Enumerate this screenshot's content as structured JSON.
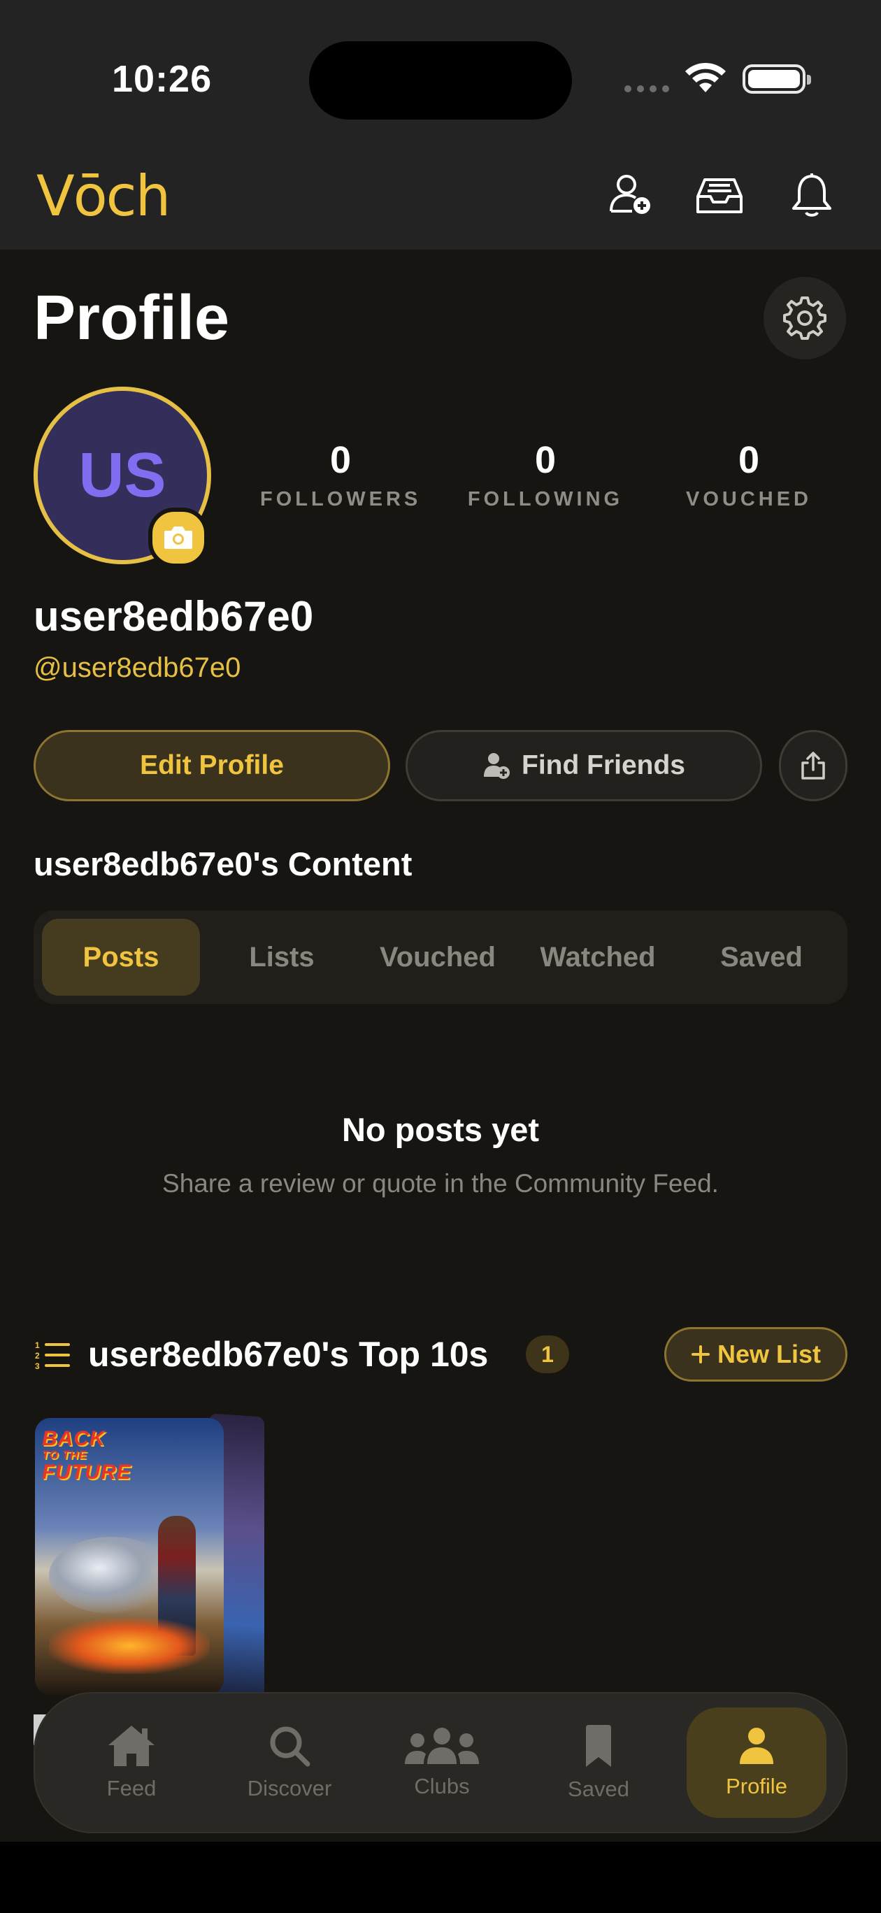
{
  "status_bar": {
    "time": "10:26"
  },
  "header": {
    "logo": "Vōch",
    "icons": [
      "add-person-icon",
      "inbox-icon",
      "bell-icon"
    ]
  },
  "profile": {
    "page_title": "Profile",
    "avatar_initials": "US",
    "stats": [
      {
        "value": "0",
        "label": "FOLLOWERS"
      },
      {
        "value": "0",
        "label": "FOLLOWING"
      },
      {
        "value": "0",
        "label": "VOUCHED"
      }
    ],
    "username": "user8edb67e0",
    "handle": "@user8edb67e0",
    "edit_label": "Edit Profile",
    "find_label": "Find Friends"
  },
  "content": {
    "title": "user8edb67e0's Content",
    "tabs": [
      "Posts",
      "Lists",
      "Vouched",
      "Watched",
      "Saved"
    ],
    "active_tab": "Posts",
    "empty_title": "No posts yet",
    "empty_subtitle": "Share a review or quote in the Community Feed."
  },
  "top10": {
    "title": "user8edb67e0's Top 10s",
    "count": "1",
    "new_list_label": "New List",
    "poster_text": [
      "BACK",
      "TO THE",
      "FUTURE"
    ]
  },
  "tabbar": {
    "items": [
      {
        "label": "Feed",
        "icon": "home-icon"
      },
      {
        "label": "Discover",
        "icon": "search-icon"
      },
      {
        "label": "Clubs",
        "icon": "group-icon"
      },
      {
        "label": "Saved",
        "icon": "bookmark-icon"
      },
      {
        "label": "Profile",
        "icon": "person-icon"
      }
    ],
    "active": "Profile"
  },
  "colors": {
    "accent": "#f0c43f",
    "background": "#171511",
    "header": "#232323",
    "avatar_bg": "#342f5a",
    "avatar_text": "#7f6ef0"
  }
}
